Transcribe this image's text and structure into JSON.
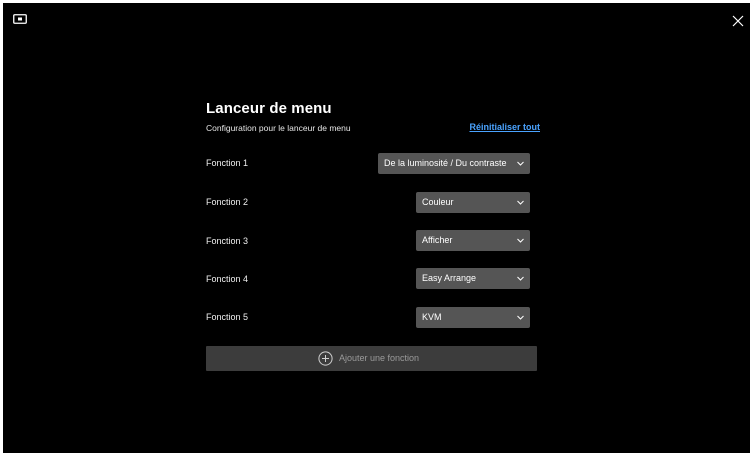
{
  "icons": {
    "app": "monitor-icon",
    "close": "close-icon",
    "chevron": "chevron-down-icon",
    "add": "plus-circle-icon"
  },
  "colors": {
    "background": "#000000",
    "select_bg": "#555555",
    "add_bg": "#3c3c3c",
    "link": "#4aa3ff"
  },
  "panel": {
    "title": "Lanceur de menu",
    "subtitle": "Configuration pour le lanceur de menu",
    "reset_label": "Réinitialiser tout"
  },
  "functions": [
    {
      "label": "Fonction 1",
      "value": "De la luminosité / Du contraste"
    },
    {
      "label": "Fonction 2",
      "value": "Couleur"
    },
    {
      "label": "Fonction 3",
      "value": "Afficher"
    },
    {
      "label": "Fonction 4",
      "value": "Easy Arrange"
    },
    {
      "label": "Fonction 5",
      "value": "KVM"
    }
  ],
  "add_button": {
    "label": "Ajouter une fonction"
  }
}
